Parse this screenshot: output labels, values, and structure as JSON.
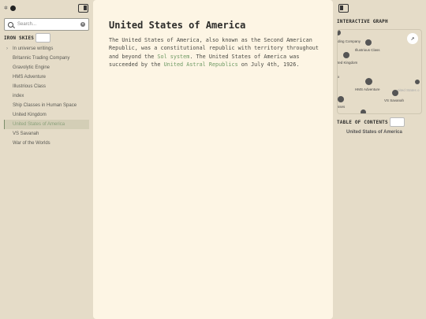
{
  "left_sidebar": {
    "search_placeholder": "Search...",
    "explorer_title": "IRON SKIES",
    "items": [
      {
        "label": "In universe writings",
        "folder": true
      },
      {
        "label": "Britannic Trading Company"
      },
      {
        "label": "Gravolytic Engine"
      },
      {
        "label": "HMS Adventure"
      },
      {
        "label": "Illustrious Class"
      },
      {
        "label": "index"
      },
      {
        "label": "Ship Classes in Human Space"
      },
      {
        "label": "United Kingdom"
      },
      {
        "label": "United States of America",
        "active": true
      },
      {
        "label": "VS Savanah"
      },
      {
        "label": "War of the Worlds"
      }
    ]
  },
  "main": {
    "title": "United States of America",
    "body_1": "The United States of America, also known as the Second American Republic, was a constitutional republic with territory throughout and beyond the ",
    "link_1": "Sol system",
    "body_2": ". The United States of America was succeeded by the ",
    "link_2": "United Astral Republics",
    "body_3": " on July 4th, 1926."
  },
  "right_sidebar": {
    "graph_title": "INTERACTIVE GRAPH",
    "graph_labels": {
      "trading": "ding Company",
      "illustrious": "Illustrious Class",
      "uk": "ted Kingdom",
      "index": "x",
      "hms": "HMS Adventure",
      "usa": "nited States o",
      "vs": "VS Savanah",
      "ship": "sses"
    },
    "toc_title": "TABLE OF CONTENTS",
    "toc_items": [
      "United States of America"
    ]
  },
  "colors": {
    "background": "#e5dcc8",
    "main_background": "#fdf5e4",
    "link": "#6f9a64",
    "active_item": "#d3ceb6"
  }
}
